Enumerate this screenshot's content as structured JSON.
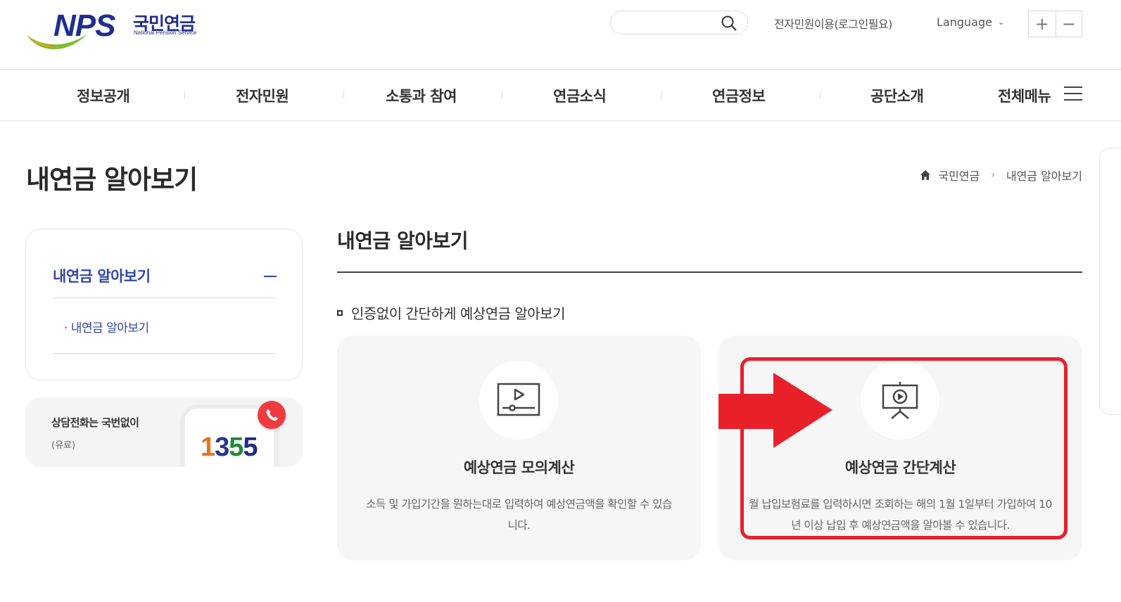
{
  "header": {
    "logo_main": "NPS",
    "logo_korean": "국민연금",
    "logo_english": "National Pension Service",
    "search_placeholder": "",
    "top_link": "전자민원이용(로그인필요)",
    "language_label": "Language",
    "zoom_in": "+",
    "zoom_out": "−"
  },
  "gnb": {
    "items": [
      "정보공개",
      "전자민원",
      "소통과 참여",
      "연금소식",
      "연금정보",
      "공단소개"
    ],
    "all_menu": "전체메뉴"
  },
  "page": {
    "title": "내연금 알아보기",
    "breadcrumb": [
      "국민연금",
      "내연금 알아보기"
    ]
  },
  "lnb": {
    "title": "내연금 알아보기",
    "sub_items": [
      "· 내연금 알아보기"
    ]
  },
  "call": {
    "title": "상담전화는 국번없이",
    "subtitle": "(유료)",
    "number_digits": [
      "1",
      "3",
      "5",
      "5"
    ]
  },
  "content": {
    "title": "내연금 알아보기",
    "section_heading": "인증없이 간단하게 예상연금 알아보기",
    "cards": [
      {
        "title": "예상연금 모의계산",
        "description": "소득 및 가입기간을 원하는대로 입력하여 예상연금액을 확인할 수 있습니다.",
        "icon": "video-player-icon"
      },
      {
        "title": "예상연금 간단계산",
        "description": "월 납입보험료를 입력하시면 조회하는 해의 1월 1일부터 가입하여 10년 이상 납입 후 예상연금액을 알아볼 수 있습니다.",
        "icon": "presentation-screen-icon"
      }
    ]
  },
  "colors": {
    "brand_blue": "#1e2f8e",
    "lnb_blue": "#2f47a9",
    "highlight_red": "#e8202a",
    "card_bg": "#f6f6f6"
  }
}
